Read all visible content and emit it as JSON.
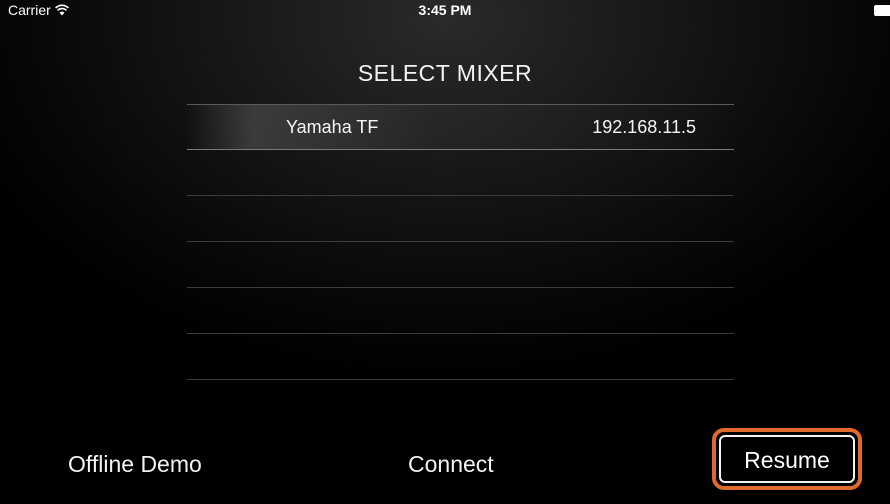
{
  "status_bar": {
    "carrier": "Carrier",
    "time": "3:45 PM"
  },
  "title": "SELECT MIXER",
  "mixers": [
    {
      "name": "Yamaha TF",
      "ip": "192.168.11.5",
      "selected": true
    },
    {
      "name": "",
      "ip": ""
    },
    {
      "name": "",
      "ip": ""
    },
    {
      "name": "",
      "ip": ""
    },
    {
      "name": "",
      "ip": ""
    },
    {
      "name": "",
      "ip": ""
    }
  ],
  "buttons": {
    "offline_demo": "Offline Demo",
    "connect": "Connect",
    "resume": "Resume"
  },
  "colors": {
    "highlight": "#e06a2c",
    "text": "#f2f2f2"
  }
}
